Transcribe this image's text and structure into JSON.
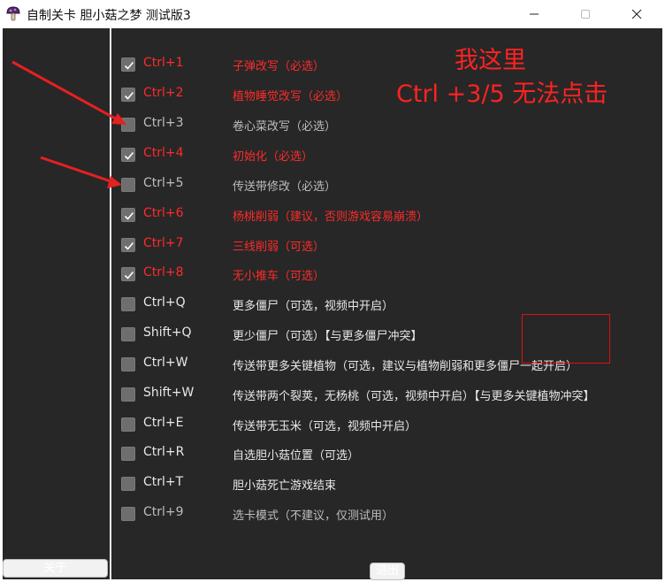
{
  "window": {
    "title": "自制关卡 胆小菇之梦 测试版3",
    "app_icon": "mushroom-icon"
  },
  "controls": {
    "minimize_icon": "minimize-icon",
    "maximize_icon": "maximize-icon",
    "close_icon": "close-icon"
  },
  "sidebar": {
    "about_label": "关于"
  },
  "footer": {
    "exit_label": "退出"
  },
  "annotation": {
    "line1": "我这里",
    "line2": "Ctrl +3/5 无法点击",
    "color": "#ff2222"
  },
  "colors": {
    "required_text": "#ff2a2a",
    "normal_text": "#e8e8e8",
    "disabled_text": "#bdbdbd",
    "background": "#272727"
  },
  "options": [
    {
      "key": "Ctrl+1",
      "desc": "子弹改写（必选）",
      "checked": true,
      "style": "red"
    },
    {
      "key": "Ctrl+2",
      "desc": "植物睡觉改写（必选）",
      "checked": true,
      "style": "red"
    },
    {
      "key": "Ctrl+3",
      "desc": "卷心菜改写（必选）",
      "checked": false,
      "style": "dim"
    },
    {
      "key": "Ctrl+4",
      "desc": "初始化（必选）",
      "checked": true,
      "style": "red"
    },
    {
      "key": "Ctrl+5",
      "desc": "传送带修改（必选）",
      "checked": false,
      "style": "dim"
    },
    {
      "key": "Ctrl+6",
      "desc": "杨桃削弱（建议，否则游戏容易崩溃）",
      "checked": true,
      "style": "red"
    },
    {
      "key": "Ctrl+7",
      "desc": "三线削弱（可选）",
      "checked": true,
      "style": "red"
    },
    {
      "key": "Ctrl+8",
      "desc": "无小推车（可选）",
      "checked": true,
      "style": "red"
    },
    {
      "key": "Ctrl+Q",
      "desc": "更多僵尸（可选，视频中开启）",
      "checked": false,
      "style": "normal"
    },
    {
      "key": "Shift+Q",
      "desc": "更少僵尸（可选）【与更多僵尸冲突】",
      "checked": false,
      "style": "normal"
    },
    {
      "key": "Ctrl+W",
      "desc": "传送带更多关键植物（可选，建议与植物削弱和更多僵尸一起开启）",
      "checked": false,
      "style": "normal"
    },
    {
      "key": "Shift+W",
      "desc": "传送带两个裂荚，无杨桃（可选，视频中开启）【与更多关键植物冲突】",
      "checked": false,
      "style": "normal"
    },
    {
      "key": "Ctrl+E",
      "desc": "传送带无玉米（可选，视频中开启）",
      "checked": false,
      "style": "normal"
    },
    {
      "key": "Ctrl+R",
      "desc": "自选胆小菇位置（可选）",
      "checked": false,
      "style": "normal"
    },
    {
      "key": "Ctrl+T",
      "desc": "胆小菇死亡游戏结束",
      "checked": false,
      "style": "normal"
    },
    {
      "key": "Ctrl+9",
      "desc": "选卡模式（不建议，仅测试用）",
      "checked": false,
      "style": "dim"
    }
  ]
}
